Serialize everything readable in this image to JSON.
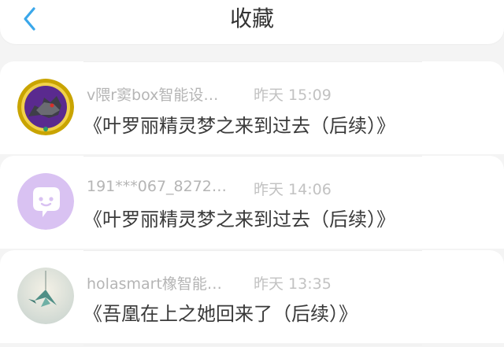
{
  "header": {
    "title": "收藏",
    "back_icon": "chevron-left-icon"
  },
  "colors": {
    "background": "#f4f4f4",
    "accent": "#3aa7ea",
    "username": "#b5b5b5",
    "time": "#c2c2c2",
    "title_text": "#3a3a3a"
  },
  "items": [
    {
      "username": "v隈r窦box智能设…",
      "time": "昨天 15:09",
      "title": "《叶罗丽精灵梦之来到过去（后续）》",
      "avatar": "dark-creature-avatar"
    },
    {
      "username": "191***067_8272…",
      "time": "昨天 14:06",
      "title": "《叶罗丽精灵梦之来到过去（后续）》",
      "avatar": "chat-bubble-avatar"
    },
    {
      "username": "holasmart橡智能…",
      "time": "昨天 13:35",
      "title": "《吾凰在上之她回来了（后续）》",
      "avatar": "paper-crane-avatar"
    }
  ]
}
